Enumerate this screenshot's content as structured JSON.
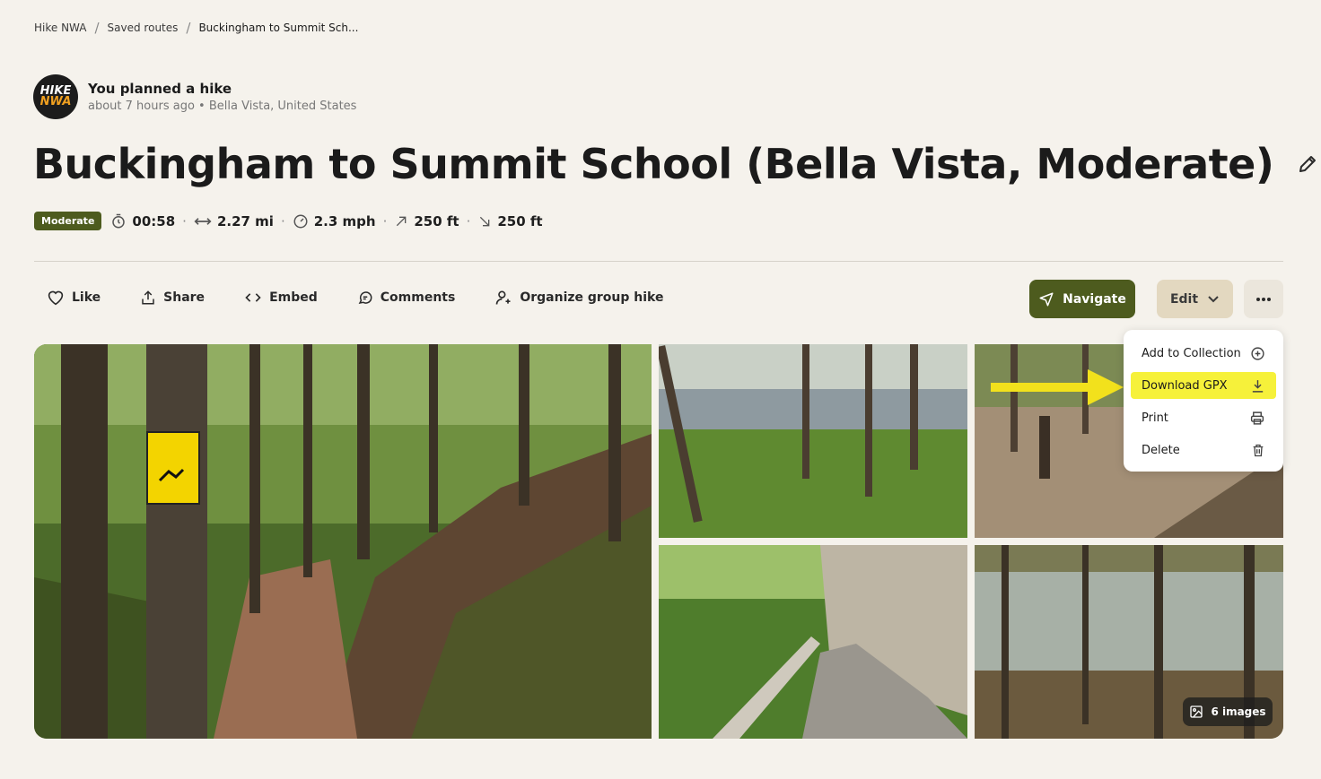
{
  "breadcrumb": {
    "items": [
      "Hike NWA",
      "Saved routes",
      "Buckingham to Summit Sch..."
    ],
    "separator": "/"
  },
  "owner": {
    "logo_line1": "HIKE",
    "logo_line2": "NWA",
    "title": "You planned a hike",
    "time": "about 7 hours ago",
    "location": "Bella Vista, United States",
    "bullet": "•"
  },
  "page_title": "Buckingham to Summit School (Bella Vista, Moderate)",
  "stats": {
    "difficulty": "Moderate",
    "duration": "00:58",
    "distance": "2.27 mi",
    "speed": "2.3 mph",
    "ascent": "250 ft",
    "descent": "250 ft",
    "separator": "·"
  },
  "actions": {
    "like": "Like",
    "share": "Share",
    "embed": "Embed",
    "comments": "Comments",
    "group": "Organize group hike"
  },
  "buttons": {
    "navigate": "Navigate",
    "edit": "Edit"
  },
  "menu": {
    "items": [
      "Add to Collection",
      "Download GPX",
      "Print",
      "Delete"
    ],
    "highlighted": "Download GPX"
  },
  "gallery": {
    "count_label": "6 images"
  },
  "colors": {
    "background": "#f5f2ec",
    "brand_green": "#4d5b1e",
    "edit_tan": "#e3d8c0",
    "highlight_yellow": "#f6f13a"
  }
}
